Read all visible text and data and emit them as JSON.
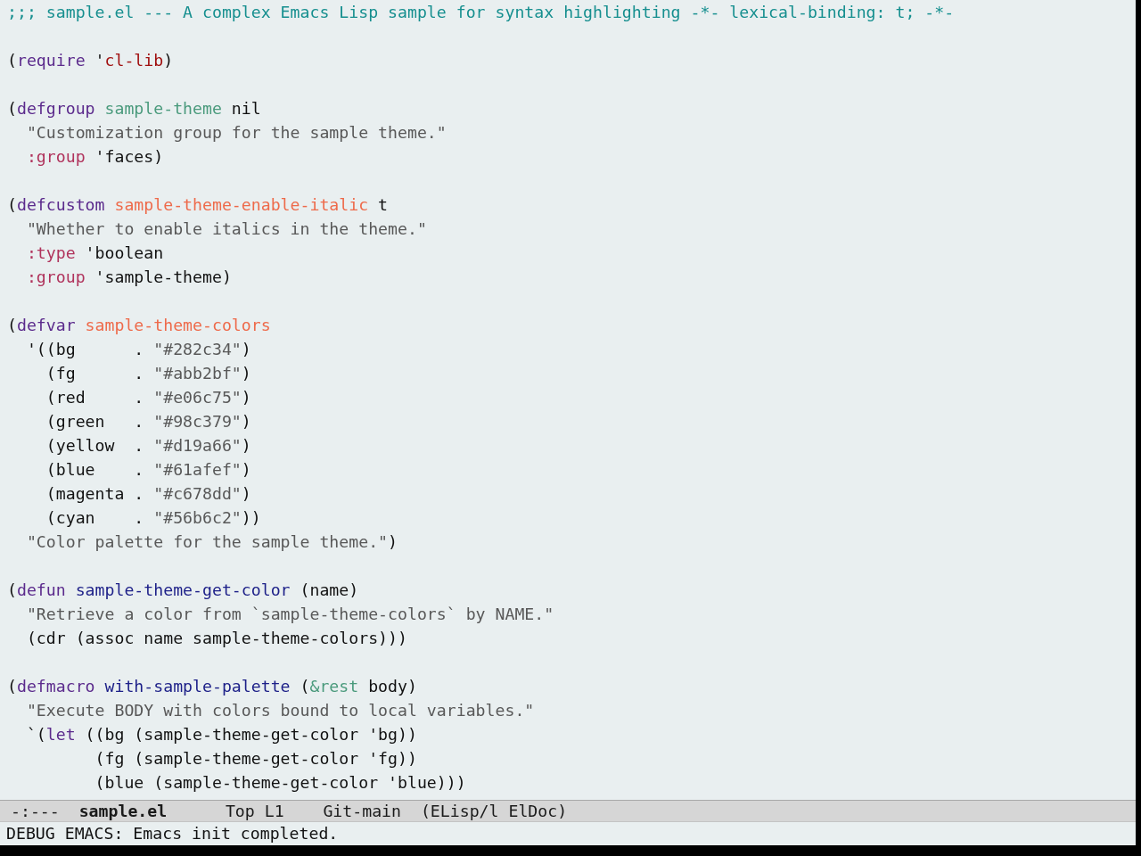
{
  "buffer": {
    "lines": [
      {
        "kind": "code",
        "tokens": [
          {
            "kind": "comment",
            "text": ";;; sample.el --- A complex Emacs Lisp sample for syntax highlighting -*- lexical-binding: t; -*-"
          }
        ]
      },
      {
        "kind": "blank"
      },
      {
        "kind": "code",
        "tokens": [
          {
            "kind": "plain",
            "text": "("
          },
          {
            "kind": "keyword",
            "text": "require"
          },
          {
            "kind": "plain",
            "text": " '"
          },
          {
            "kind": "constant",
            "text": "cl-lib"
          },
          {
            "kind": "plain",
            "text": ")"
          }
        ]
      },
      {
        "kind": "blank"
      },
      {
        "kind": "code",
        "tokens": [
          {
            "kind": "plain",
            "text": "("
          },
          {
            "kind": "keyword",
            "text": "defgroup"
          },
          {
            "kind": "type",
            "text": " sample-theme"
          },
          {
            "kind": "plain",
            "text": " nil"
          }
        ]
      },
      {
        "kind": "code",
        "tokens": [
          {
            "kind": "string",
            "text": "  \"Customization group for the sample theme.\""
          }
        ]
      },
      {
        "kind": "code",
        "tokens": [
          {
            "kind": "builtin",
            "text": "  :group"
          },
          {
            "kind": "plain",
            "text": " 'faces)"
          }
        ]
      },
      {
        "kind": "blank"
      },
      {
        "kind": "code",
        "tokens": [
          {
            "kind": "plain",
            "text": "("
          },
          {
            "kind": "keyword",
            "text": "defcustom"
          },
          {
            "kind": "variable",
            "text": " sample-theme-enable-italic"
          },
          {
            "kind": "plain",
            "text": " t"
          }
        ]
      },
      {
        "kind": "code",
        "tokens": [
          {
            "kind": "string",
            "text": "  \"Whether to enable italics in the theme.\""
          }
        ]
      },
      {
        "kind": "code",
        "tokens": [
          {
            "kind": "builtin",
            "text": "  :type"
          },
          {
            "kind": "plain",
            "text": " 'boolean"
          }
        ]
      },
      {
        "kind": "code",
        "tokens": [
          {
            "kind": "builtin",
            "text": "  :group"
          },
          {
            "kind": "plain",
            "text": " 'sample-theme)"
          }
        ]
      },
      {
        "kind": "blank"
      },
      {
        "kind": "code",
        "tokens": [
          {
            "kind": "plain",
            "text": "("
          },
          {
            "kind": "keyword",
            "text": "defvar"
          },
          {
            "kind": "variable",
            "text": " sample-theme-colors"
          }
        ]
      },
      {
        "kind": "code",
        "tokens": [
          {
            "kind": "plain",
            "text": "  '((bg      . "
          },
          {
            "kind": "string",
            "text": "\"#282c34\""
          },
          {
            "kind": "plain",
            "text": ")"
          }
        ]
      },
      {
        "kind": "code",
        "tokens": [
          {
            "kind": "plain",
            "text": "    (fg      . "
          },
          {
            "kind": "string",
            "text": "\"#abb2bf\""
          },
          {
            "kind": "plain",
            "text": ")"
          }
        ]
      },
      {
        "kind": "code",
        "tokens": [
          {
            "kind": "plain",
            "text": "    (red     . "
          },
          {
            "kind": "string",
            "text": "\"#e06c75\""
          },
          {
            "kind": "plain",
            "text": ")"
          }
        ]
      },
      {
        "kind": "code",
        "tokens": [
          {
            "kind": "plain",
            "text": "    (green   . "
          },
          {
            "kind": "string",
            "text": "\"#98c379\""
          },
          {
            "kind": "plain",
            "text": ")"
          }
        ]
      },
      {
        "kind": "code",
        "tokens": [
          {
            "kind": "plain",
            "text": "    (yellow  . "
          },
          {
            "kind": "string",
            "text": "\"#d19a66\""
          },
          {
            "kind": "plain",
            "text": ")"
          }
        ]
      },
      {
        "kind": "code",
        "tokens": [
          {
            "kind": "plain",
            "text": "    (blue    . "
          },
          {
            "kind": "string",
            "text": "\"#61afef\""
          },
          {
            "kind": "plain",
            "text": ")"
          }
        ]
      },
      {
        "kind": "code",
        "tokens": [
          {
            "kind": "plain",
            "text": "    (magenta . "
          },
          {
            "kind": "string",
            "text": "\"#c678dd\""
          },
          {
            "kind": "plain",
            "text": ")"
          }
        ]
      },
      {
        "kind": "code",
        "tokens": [
          {
            "kind": "plain",
            "text": "    (cyan    . "
          },
          {
            "kind": "string",
            "text": "\"#56b6c2\""
          },
          {
            "kind": "plain",
            "text": "))"
          }
        ]
      },
      {
        "kind": "code",
        "tokens": [
          {
            "kind": "string",
            "text": "  \"Color palette for the sample theme.\""
          },
          {
            "kind": "plain",
            "text": ")"
          }
        ]
      },
      {
        "kind": "blank"
      },
      {
        "kind": "code",
        "tokens": [
          {
            "kind": "plain",
            "text": "("
          },
          {
            "kind": "keyword",
            "text": "defun"
          },
          {
            "kind": "function",
            "text": " sample-theme-get-color"
          },
          {
            "kind": "plain",
            "text": " (name)"
          }
        ]
      },
      {
        "kind": "code",
        "tokens": [
          {
            "kind": "string",
            "text": "  \"Retrieve a color from `sample-theme-colors` by NAME.\""
          }
        ]
      },
      {
        "kind": "code",
        "tokens": [
          {
            "kind": "plain",
            "text": "  (cdr (assoc name sample-theme-colors)))"
          }
        ]
      },
      {
        "kind": "blank"
      },
      {
        "kind": "code",
        "tokens": [
          {
            "kind": "plain",
            "text": "("
          },
          {
            "kind": "keyword",
            "text": "defmacro"
          },
          {
            "kind": "function",
            "text": " with-sample-palette"
          },
          {
            "kind": "plain",
            "text": " ("
          },
          {
            "kind": "type",
            "text": "&rest"
          },
          {
            "kind": "plain",
            "text": " body)"
          }
        ]
      },
      {
        "kind": "code",
        "tokens": [
          {
            "kind": "string",
            "text": "  \"Execute BODY with colors bound to local variables.\""
          }
        ]
      },
      {
        "kind": "code",
        "tokens": [
          {
            "kind": "plain",
            "text": "  `("
          },
          {
            "kind": "keyword",
            "text": "let"
          },
          {
            "kind": "plain",
            "text": " ((bg (sample-theme-get-color 'bg))"
          }
        ]
      },
      {
        "kind": "code",
        "tokens": [
          {
            "kind": "plain",
            "text": "         (fg (sample-theme-get-color 'fg))"
          }
        ]
      },
      {
        "kind": "code",
        "tokens": [
          {
            "kind": "plain",
            "text": "         (blue (sample-theme-get-color 'blue)))"
          }
        ]
      }
    ]
  },
  "mode_line": {
    "status": "-:---",
    "buffer_name": "sample.el",
    "position": "Top L1",
    "vc_branch": "Git-main",
    "modes": "(ELisp/l ElDoc)"
  },
  "echo_area": {
    "message": "DEBUG EMACS: Emacs init completed."
  }
}
